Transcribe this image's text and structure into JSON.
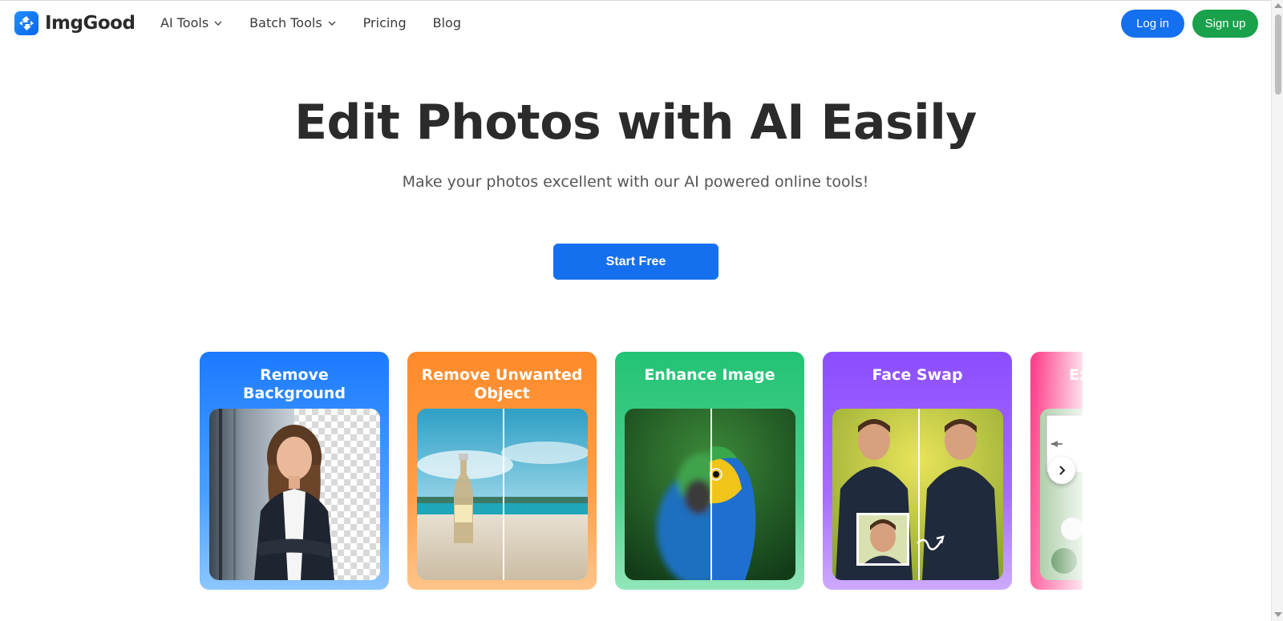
{
  "brand": {
    "name": "ImgGood",
    "accent": "#1570ef",
    "signup_color": "#19a14b"
  },
  "nav": {
    "items": [
      {
        "label": "AI Tools",
        "has_dropdown": true
      },
      {
        "label": "Batch Tools",
        "has_dropdown": true
      },
      {
        "label": "Pricing",
        "has_dropdown": false
      },
      {
        "label": "Blog",
        "has_dropdown": false
      }
    ],
    "login_label": "Log in",
    "signup_label": "Sign up"
  },
  "hero": {
    "title": "Edit Photos with AI Easily",
    "subtitle": "Make your photos excellent with our AI powered online tools!",
    "cta_label": "Start Free"
  },
  "tools": [
    {
      "title": "Remove Background",
      "color": "#1c7aff",
      "icon": "woman-portrait-image"
    },
    {
      "title": "Remove Unwanted Object",
      "color": "#ff8a2a",
      "icon": "beach-bottle-image"
    },
    {
      "title": "Enhance Image",
      "color": "#22c374",
      "icon": "parrot-image"
    },
    {
      "title": "Face Swap",
      "color": "#8c4dff",
      "icon": "man-hoodie-image"
    },
    {
      "title": "Ex",
      "color": "#ff3e8a",
      "icon": "flowers-image"
    }
  ],
  "carousel": {
    "next_icon": "chevron-right-icon"
  }
}
